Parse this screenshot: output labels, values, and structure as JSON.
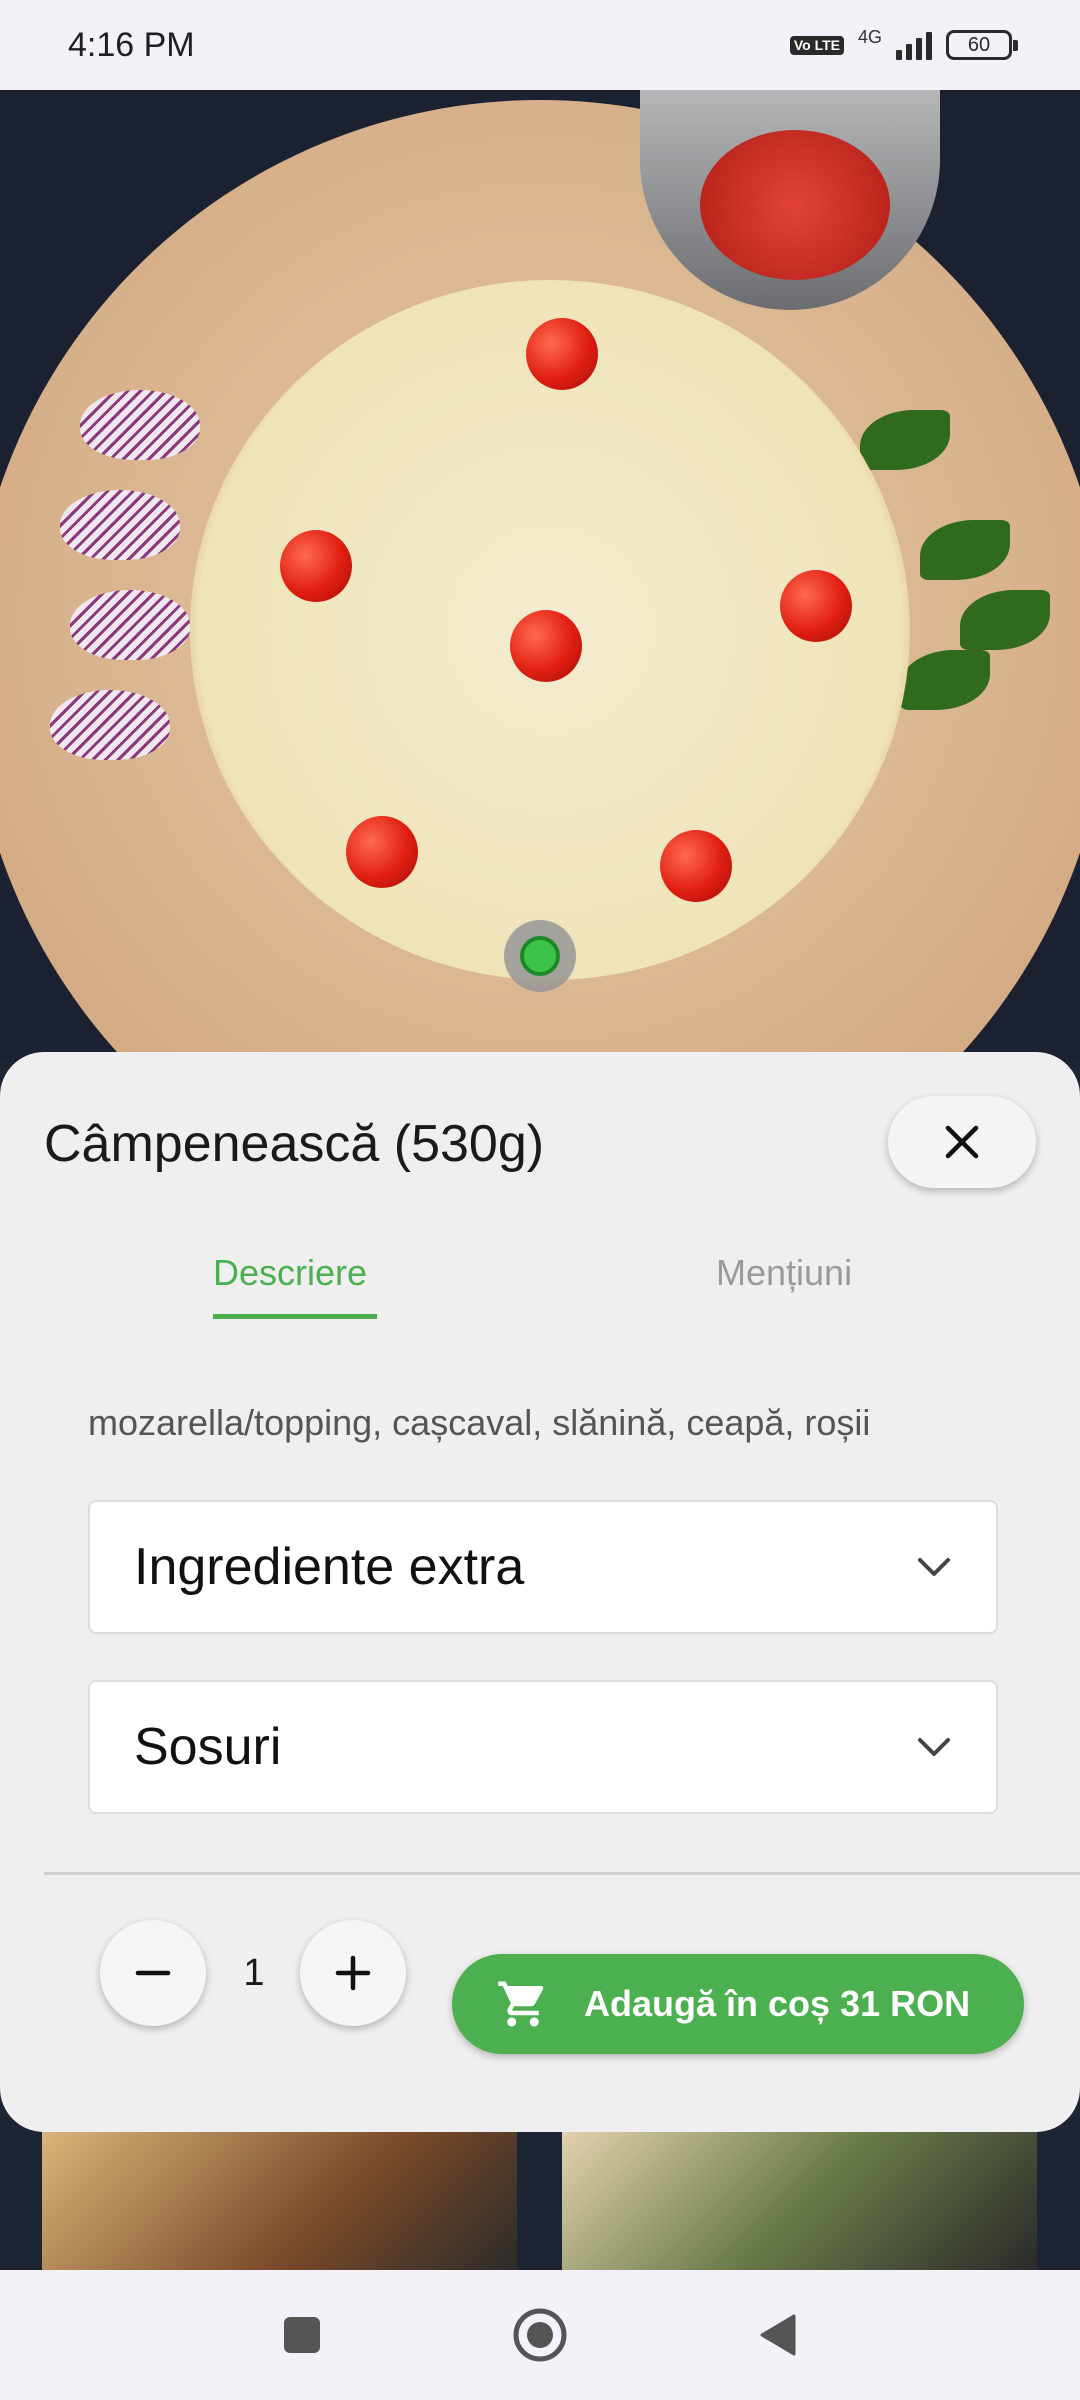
{
  "status_bar": {
    "time": "4:16 PM",
    "volte": "Vo LTE",
    "network": "4G",
    "battery": "60"
  },
  "product": {
    "title": "Câmpenească (530g)",
    "description": "mozarella/topping, cașcaval, slănină, ceapă, roșii"
  },
  "tabs": [
    {
      "label": "Descriere",
      "active": true
    },
    {
      "label": "Mențiuni",
      "active": false
    }
  ],
  "accordions": [
    {
      "label": "Ingrediente extra"
    },
    {
      "label": "Sosuri"
    }
  ],
  "quantity": {
    "value": "1"
  },
  "add_to_cart": {
    "label": "Adaugă în coș 31 RON"
  },
  "colors": {
    "accent": "#4caf50",
    "sheet_bg": "#efefef",
    "text_primary": "#1a1a1a",
    "text_muted": "#9a9a9a"
  },
  "icons": {
    "close": "close-icon",
    "chevron": "chevron-down-icon",
    "minus": "minus-icon",
    "plus": "plus-icon",
    "cart": "cart-icon",
    "nav_recent": "square-icon",
    "nav_home": "circle-icon",
    "nav_back": "triangle-back-icon"
  }
}
